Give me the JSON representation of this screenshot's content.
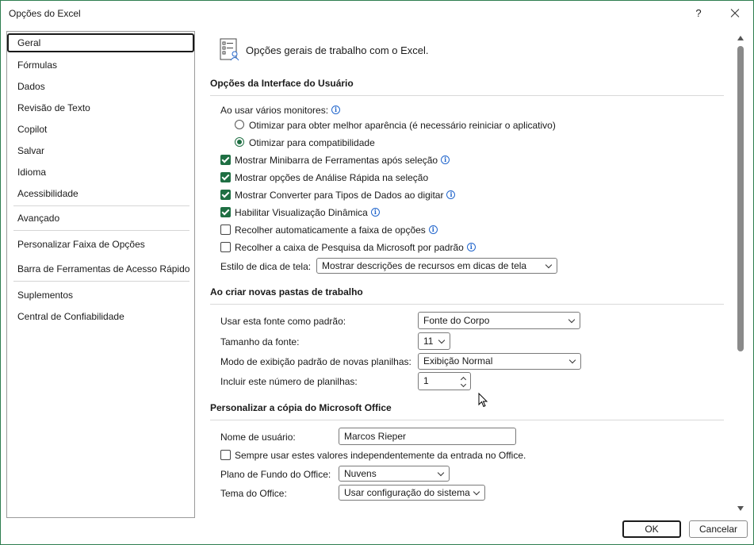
{
  "window": {
    "title": "Opções do Excel",
    "help_label": "?"
  },
  "sidebar": {
    "items": [
      {
        "label": "Geral",
        "selected": true
      },
      {
        "label": "Fórmulas"
      },
      {
        "label": "Dados"
      },
      {
        "label": "Revisão de Texto"
      },
      {
        "label": "Copilot"
      },
      {
        "label": "Salvar"
      },
      {
        "label": "Idioma"
      },
      {
        "label": "Acessibilidade"
      },
      {
        "label": "Avançado"
      },
      {
        "label": "Personalizar Faixa de Opções"
      },
      {
        "label": "Barra de Ferramentas de Acesso Rápido"
      },
      {
        "label": "Suplementos"
      },
      {
        "label": "Central de Confiabilidade"
      }
    ]
  },
  "header": {
    "text": "Opções gerais de trabalho com o Excel."
  },
  "ui_options": {
    "title": "Opções da Interface do Usuário",
    "monitors_label": "Ao usar vários monitores:",
    "radio_best": "Otimizar para obter melhor aparência (é necessário reiniciar o aplicativo)",
    "radio_compat": "Otimizar para compatibilidade",
    "cb_minibar": "Mostrar Minibarra de Ferramentas após seleção",
    "cb_quick_analysis": "Mostrar opções de Análise Rápida na seleção",
    "cb_convert": "Mostrar Converter para Tipos de Dados ao digitar",
    "cb_live_preview": "Habilitar Visualização Dinâmica",
    "cb_collapse_ribbon": "Recolher automaticamente a faixa de opções",
    "cb_collapse_search": "Recolher a caixa de Pesquisa da Microsoft por padrão",
    "tooltip_label": "Estilo de dica de tela:",
    "tooltip_value": "Mostrar descrições de recursos em dicas de tela"
  },
  "new_workbooks": {
    "title": "Ao criar novas pastas de trabalho",
    "font_label": "Usar esta fonte como padrão:",
    "font_value": "Fonte do Corpo",
    "size_label": "Tamanho da fonte:",
    "size_value": "11",
    "view_label": "Modo de exibição padrão de novas planilhas:",
    "view_value": "Exibição Normal",
    "sheets_label": "Incluir este número de planilhas:",
    "sheets_value": "1"
  },
  "personalize": {
    "title": "Personalizar a cópia do Microsoft Office",
    "username_label": "Nome de usuário:",
    "username_value": "Marcos Rieper",
    "always_use_label": "Sempre usar estes valores independentemente da entrada no Office.",
    "background_label": "Plano de Fundo do Office:",
    "background_value": "Nuvens",
    "theme_label": "Tema do Office:",
    "theme_value": "Usar configuração do sistema"
  },
  "footer": {
    "ok_label": "OK",
    "cancel_label": "Cancelar"
  },
  "colors": {
    "accent": "#1f6f43",
    "info": "#2266cc",
    "frame": "#2e7d4f"
  }
}
